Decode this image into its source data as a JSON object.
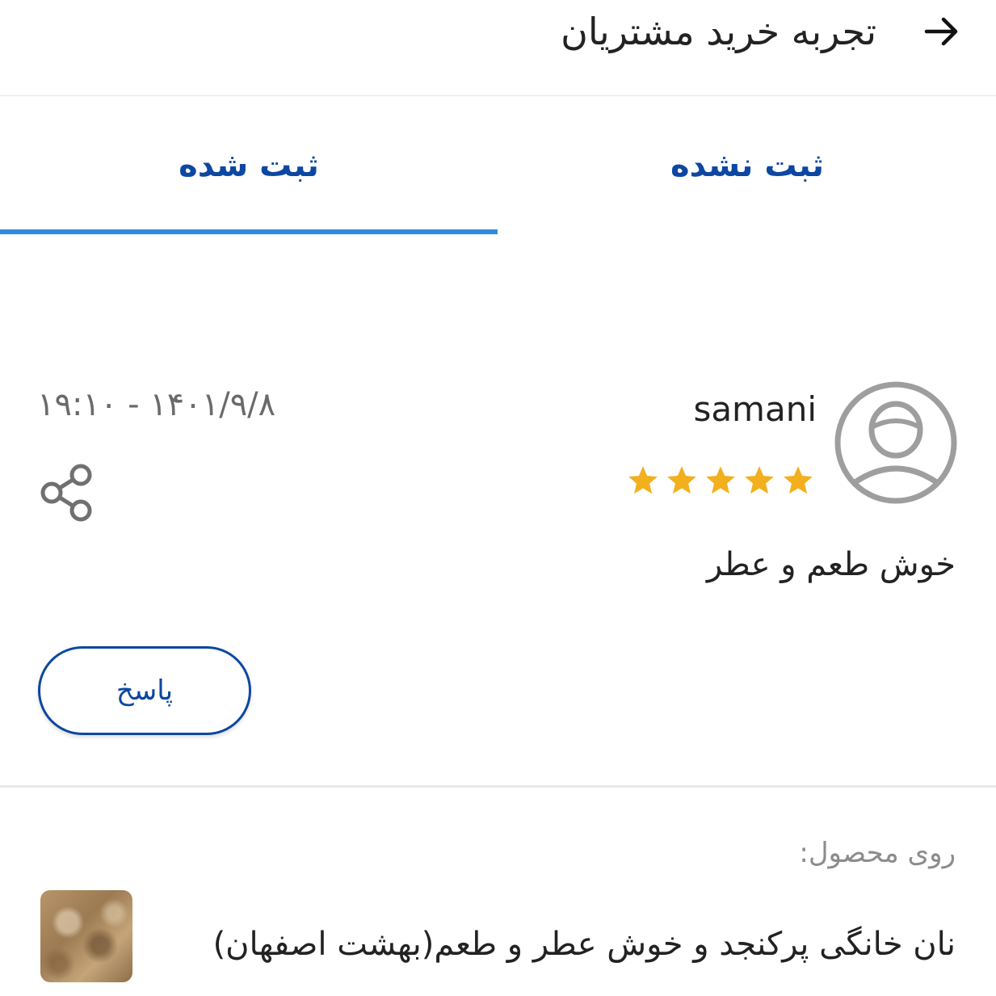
{
  "header": {
    "title": "تجربه خرید مشتریان",
    "back_icon": "arrow-right-icon"
  },
  "tabs": [
    {
      "label": "ثبت نشده",
      "active": false
    },
    {
      "label": "ثبت شده",
      "active": true
    }
  ],
  "accent_color": "#0d47a1",
  "indicator_color": "#2f8ae0",
  "review": {
    "username": "samani",
    "rating": 5,
    "max_rating": 5,
    "timestamp": "۱۹:۱۰ - ۱۴۰۱/۹/۸",
    "text": "خوش طعم و عطر",
    "reply_label": "پاسخ",
    "avatar_icon": "user-avatar-icon",
    "share_icon": "share-icon"
  },
  "product": {
    "label": "روی محصول:",
    "name": "نان خانگی پرکنجد و خوش عطر و طعم(بهشت اصفهان)"
  }
}
